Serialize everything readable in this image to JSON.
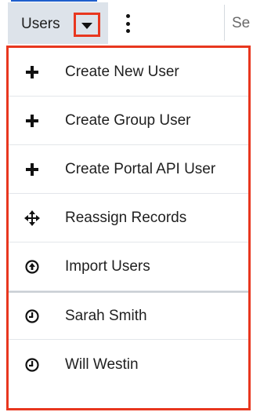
{
  "nav": {
    "users_label": "Users",
    "search_label": "Se"
  },
  "menu": {
    "items": [
      {
        "label": "Create New User",
        "icon": "plus-icon"
      },
      {
        "label": "Create Group User",
        "icon": "plus-icon"
      },
      {
        "label": "Create Portal API User",
        "icon": "plus-icon"
      },
      {
        "label": "Reassign Records",
        "icon": "move-arrows-icon"
      },
      {
        "label": "Import Users",
        "icon": "upload-circle-icon"
      },
      {
        "label": "Sarah Smith",
        "icon": "clock-icon"
      },
      {
        "label": "Will Westin",
        "icon": "clock-icon"
      }
    ]
  },
  "colors": {
    "highlight": "#e8371f",
    "tab_background": "#dde3ea",
    "text": "#1f1f1f",
    "link": "#1f5fcc"
  }
}
